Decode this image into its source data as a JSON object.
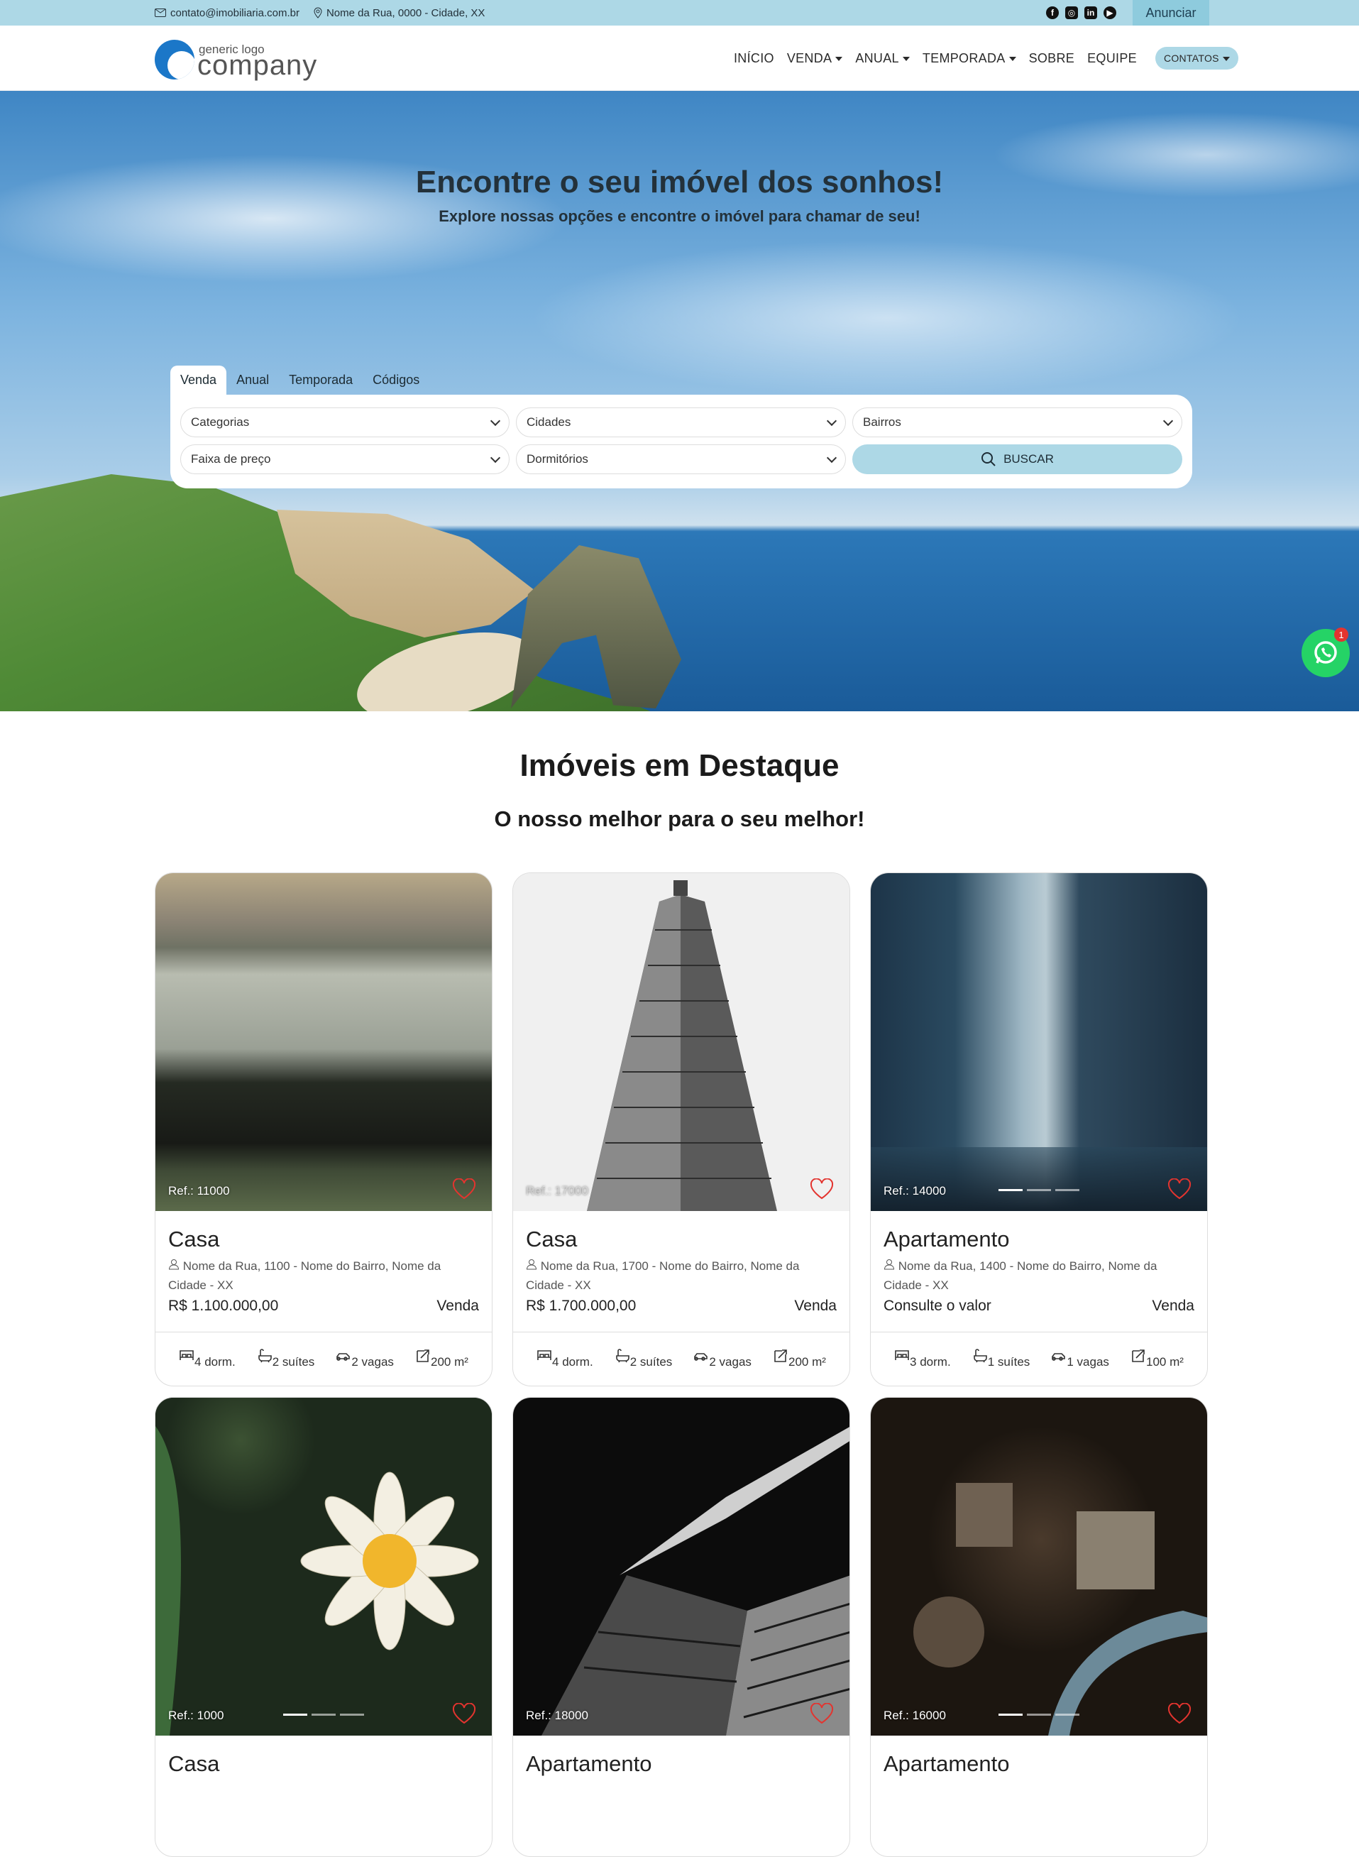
{
  "topbar": {
    "email": "contato@imobiliaria.com.br",
    "address": "Nome da Rua, 0000 - Cidade, XX",
    "social": [
      "facebook-icon",
      "instagram-icon",
      "linkedin-icon",
      "youtube-icon"
    ],
    "anunciar": "Anunciar"
  },
  "header": {
    "logo_small": "generic logo",
    "logo_big": "company",
    "nav": [
      "INÍCIO",
      "VENDA",
      "ANUAL",
      "TEMPORADA",
      "SOBRE",
      "EQUIPE"
    ],
    "contatos": "CONTATOS"
  },
  "hero": {
    "title": "Encontre o seu imóvel dos sonhos!",
    "subtitle": "Explore nossas opções e encontre o imóvel para chamar de seu!",
    "tabs": [
      "Venda",
      "Anual",
      "Temporada",
      "Códigos"
    ],
    "selects": [
      "Categorias",
      "Cidades",
      "Bairros",
      "Faixa de preço",
      "Dormitórios"
    ],
    "search_button": "BUSCAR"
  },
  "whatsapp": {
    "badge": "1"
  },
  "featured": {
    "title": "Imóveis em Destaque",
    "subtitle": "O nosso melhor para o seu melhor!",
    "cards": [
      {
        "ref": "Ref.: 11000",
        "type": "Casa",
        "address": "Nome da Rua, 1100 - Nome do Bairro, Nome da Cidade - XX",
        "price": "R$ 1.100.000,00",
        "deal": "Venda",
        "dorm": "4 dorm.",
        "suites": "2 suítes",
        "vagas": "2 vagas",
        "area": "200 m²"
      },
      {
        "ref": "Ref.: 17000",
        "type": "Casa",
        "address": "Nome da Rua, 1700 - Nome do Bairro, Nome da Cidade - XX",
        "price": "R$ 1.700.000,00",
        "deal": "Venda",
        "dorm": "4 dorm.",
        "suites": "2 suítes",
        "vagas": "2 vagas",
        "area": "200 m²"
      },
      {
        "ref": "Ref.: 14000",
        "type": "Apartamento",
        "address": "Nome da Rua, 1400 - Nome do Bairro, Nome da Cidade - XX",
        "price": "Consulte o valor",
        "deal": "Venda",
        "dorm": "3 dorm.",
        "suites": "1 suítes",
        "vagas": "1 vagas",
        "area": "100 m²"
      },
      {
        "ref": "Ref.: 1000",
        "type": "Casa"
      },
      {
        "ref": "Ref.: 18000",
        "type": "Apartamento"
      },
      {
        "ref": "Ref.: 16000",
        "type": "Apartamento"
      }
    ]
  }
}
